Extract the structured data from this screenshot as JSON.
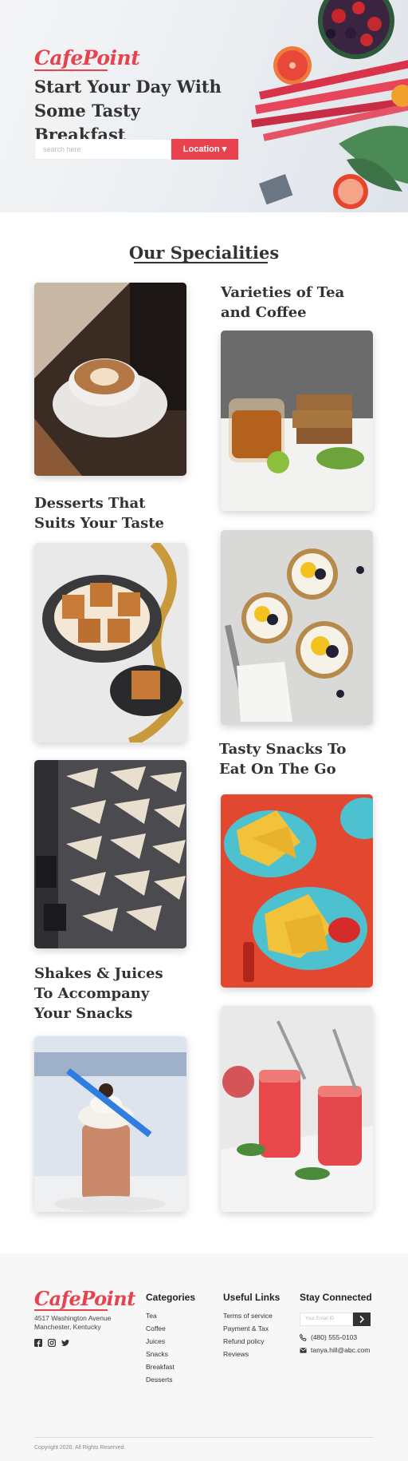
{
  "brand": {
    "name": "CafePoint",
    "color": "#e8424e"
  },
  "hero": {
    "title": "Start Your Day With Some Tasty Breakfast",
    "search_placeholder": "search here",
    "location_label": "Location"
  },
  "specialities": {
    "title": "Our Specialities",
    "sections": [
      {
        "heading": "Varieties of  Tea and Coffee"
      },
      {
        "heading": "Desserts That Suits Your Taste"
      },
      {
        "heading": "Tasty Snacks To Eat On The Go"
      },
      {
        "heading": "Shakes & Juices To Accompany Your Snacks"
      }
    ]
  },
  "footer": {
    "address_line1": "4517 Washington Avenue",
    "address_line2": "Manchester, Kentucky",
    "social": [
      "facebook-icon",
      "instagram-icon",
      "twitter-icon"
    ],
    "categories": {
      "title": "Categories",
      "items": [
        "Tea",
        "Coffee",
        "Juices",
        "Snacks",
        "Breakfast",
        "Desserts"
      ]
    },
    "useful_links": {
      "title": "Useful Links",
      "items": [
        "Terms of service",
        "Payment & Tax",
        "Refund policy",
        "Reviews"
      ]
    },
    "stay_connected": {
      "title": "Stay Connected",
      "email_placeholder": "Your Email ID",
      "phone": "(480) 555-0103",
      "email": "tanya.hill@abc.com"
    },
    "copyright": "Copyright 2020. All Rights Reserved."
  }
}
